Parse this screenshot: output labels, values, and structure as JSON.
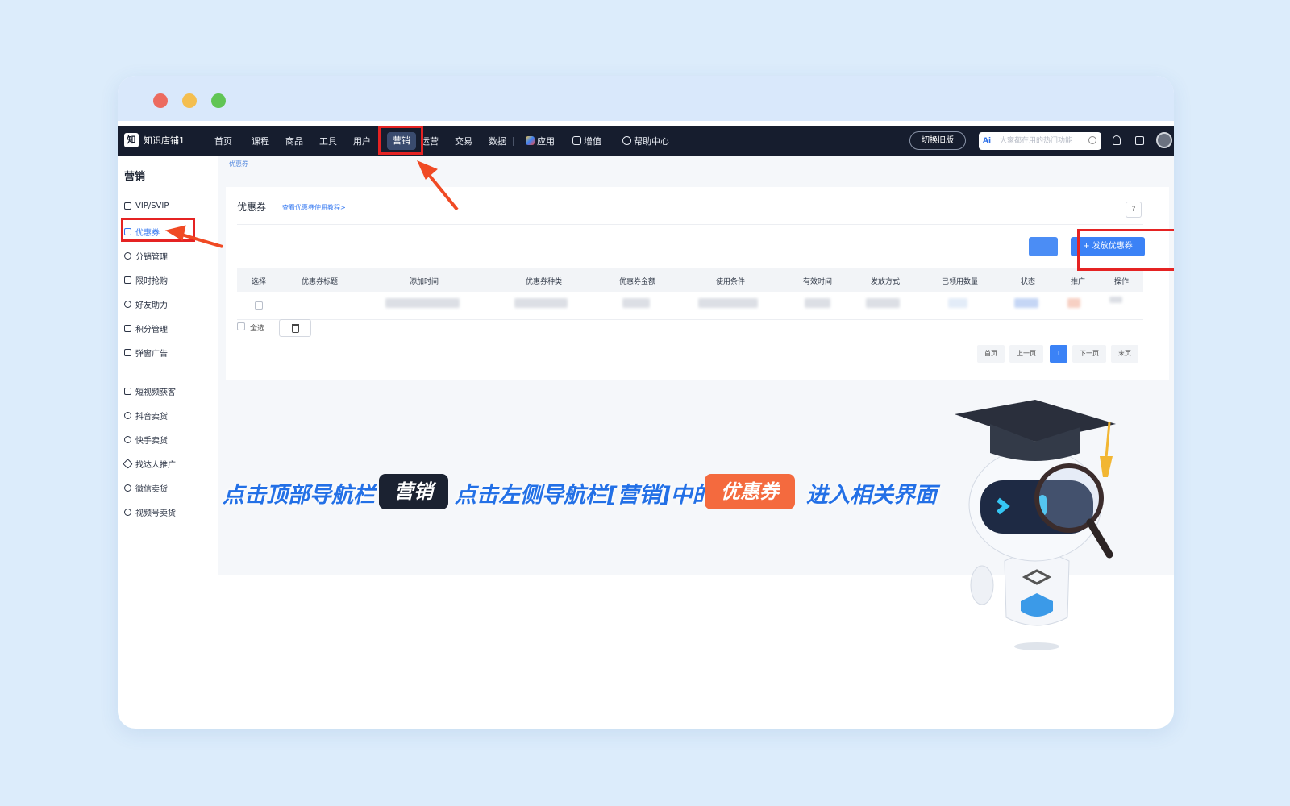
{
  "topnav": {
    "brand": "知识店铺1",
    "items": [
      "首页",
      "课程",
      "商品",
      "工具",
      "用户",
      "营销",
      "运营",
      "交易",
      "数据",
      "应用",
      "增值",
      "帮助中心"
    ],
    "switch_label": "切换旧版",
    "search_placeholder": "大家都在用的热门功能",
    "search_ai": "Ai"
  },
  "sidebar": {
    "title": "营销",
    "group1": [
      "VIP/SVIP",
      "优惠券",
      "分销管理",
      "限时抢购",
      "好友助力",
      "积分管理",
      "弹窗广告"
    ],
    "group2": [
      "短视频获客",
      "抖音卖货",
      "快手卖货",
      "找达人推广",
      "微信卖货",
      "视频号卖货"
    ],
    "active": "优惠券"
  },
  "breadcrumb": "优惠券",
  "card": {
    "title": "优惠券",
    "link": "查看优惠券使用教程>",
    "help": "?",
    "issue_button": "+ 发放优惠券",
    "columns": [
      "选择",
      "优惠券标题",
      "添加时间",
      "优惠券种类",
      "优惠券金额",
      "使用条件",
      "有效时间",
      "发放方式",
      "已领用数量",
      "状态",
      "推广",
      "操作"
    ],
    "select_all": "全选",
    "pagination": [
      "首页",
      "上一页",
      "1",
      "下一页",
      "末页"
    ]
  },
  "banner": {
    "part1": "点击顶部导航栏",
    "pill1": "营销",
    "part2": "点击左侧导航栏[营销]中的",
    "pill2": "优惠券",
    "part3": "进入相关界面"
  },
  "colors": {
    "nav_bg": "#161d2e",
    "accent": "#3b82f6",
    "highlight_red": "#e52323",
    "arrow": "#f04a24",
    "banner_text": "#2370e6",
    "pill_orange": "#f46a3e"
  }
}
